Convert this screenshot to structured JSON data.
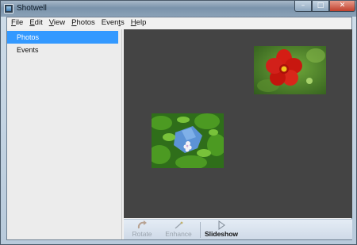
{
  "window": {
    "title": "Shotwell",
    "controls": {
      "minimize": "–",
      "maximize": "□",
      "close": "✕"
    }
  },
  "menu": [
    {
      "hotkey": "F",
      "rest": "ile"
    },
    {
      "hotkey": "E",
      "rest": "dit"
    },
    {
      "hotkey": "V",
      "rest": "iew"
    },
    {
      "hotkey": "P",
      "rest": "hotos"
    },
    {
      "hotkey": "",
      "rest": "Even",
      "hotkey2": "t",
      "rest2": "s"
    },
    {
      "hotkey": "H",
      "rest": "elp"
    }
  ],
  "sidebar": {
    "items": [
      {
        "label": "Photos",
        "selected": true
      },
      {
        "label": "Events",
        "selected": false
      }
    ]
  },
  "photos": [
    {
      "subject": "red flower on green background"
    },
    {
      "subject": "white flower in green leaves against blue sky"
    }
  ],
  "toolbar": {
    "rotate_label": "Rotate",
    "enhance_label": "Enhance",
    "slideshow_label": "Slideshow",
    "rotate_enabled": false,
    "enhance_enabled": false,
    "slideshow_enabled": true
  },
  "colors": {
    "selection": "#3399ff",
    "viewer_background": "#444444"
  }
}
